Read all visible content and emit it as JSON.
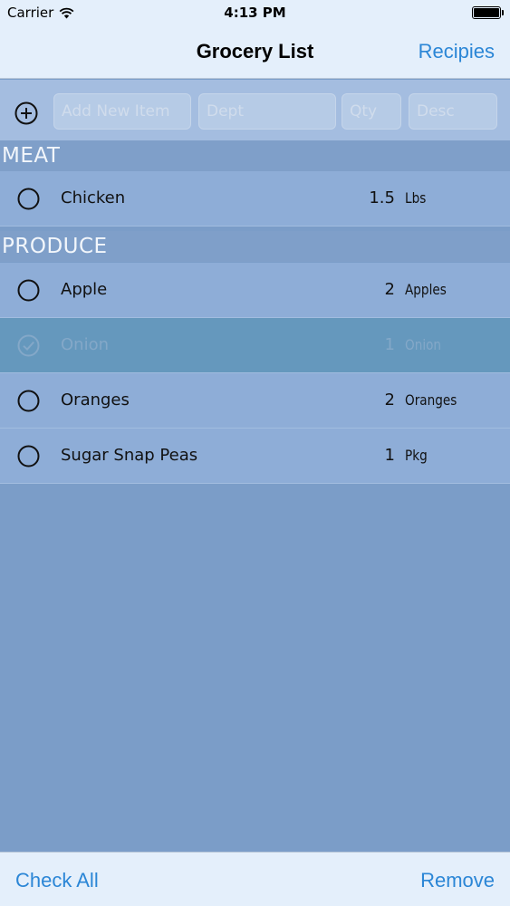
{
  "status_bar": {
    "carrier": "Carrier",
    "time": "4:13 PM"
  },
  "nav": {
    "title": "Grocery List",
    "right_button": "Recipies"
  },
  "add_bar": {
    "item_placeholder": "Add New Item",
    "dept_placeholder": "Dept",
    "qty_placeholder": "Qty",
    "desc_placeholder": "Desc"
  },
  "sections": [
    {
      "title": "MEAT",
      "items": [
        {
          "name": "Chicken",
          "qty": "1.5",
          "unit": "Lbs",
          "checked": false
        }
      ]
    },
    {
      "title": "PRODUCE",
      "items": [
        {
          "name": "Apple",
          "qty": "2",
          "unit": "Apples",
          "checked": false
        },
        {
          "name": "Onion",
          "qty": "1",
          "unit": "Onion",
          "checked": true
        },
        {
          "name": "Oranges",
          "qty": "2",
          "unit": "Oranges",
          "checked": false
        },
        {
          "name": "Sugar Snap Peas",
          "qty": "1",
          "unit": "Pkg",
          "checked": false
        }
      ]
    }
  ],
  "toolbar": {
    "check_all": "Check All",
    "remove": "Remove"
  },
  "colors": {
    "accent": "#2b86d6",
    "background": "#7b9dc8",
    "row": "#8eadd7",
    "checked_row": "#6598bd"
  }
}
